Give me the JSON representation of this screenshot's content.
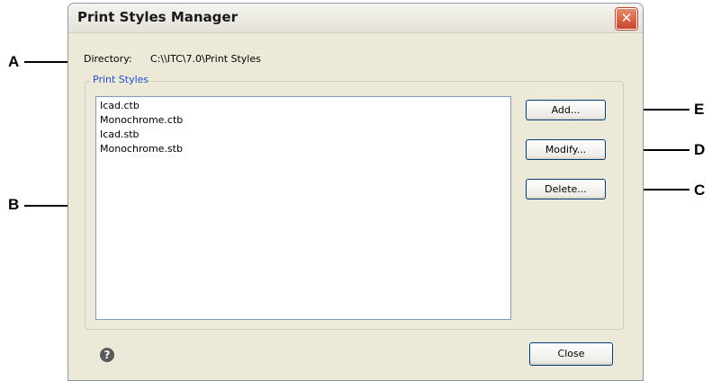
{
  "dialog": {
    "title": "Print Styles Manager",
    "close_glyph": "✕",
    "directory_label": "Directory:",
    "directory_value": "C:\\\\ITC\\7.0\\Print Styles",
    "group_label": "Print Styles",
    "list_items": [
      "Icad.ctb",
      "Monochrome.ctb",
      "Icad.stb",
      "Monochrome.stb"
    ],
    "buttons": {
      "add": "Add...",
      "modify": "Modify...",
      "delete": "Delete...",
      "close": "Close"
    },
    "help_glyph": "?"
  },
  "callouts": {
    "a": "A",
    "b": "B",
    "c": "C",
    "d": "D",
    "e": "E"
  },
  "icons": {
    "close": "close-icon",
    "help": "help-icon"
  }
}
